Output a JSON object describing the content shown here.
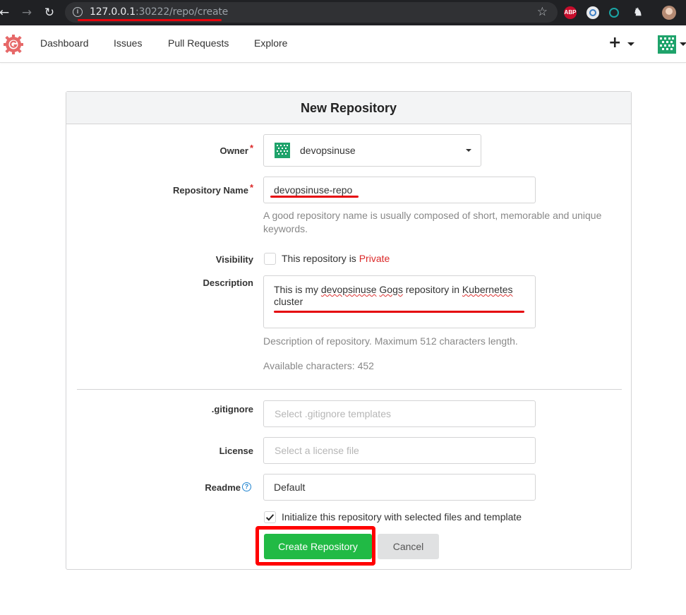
{
  "browser": {
    "url_host": "127.0.0.1",
    "url_rest": ":30222/repo/create",
    "back_icon": "arrow-left-icon",
    "forward_icon": "arrow-right-icon",
    "reload_icon": "reload-icon",
    "extensions": {
      "abp": "ABP"
    }
  },
  "nav": {
    "items": [
      "Dashboard",
      "Issues",
      "Pull Requests",
      "Explore"
    ],
    "plus": "+"
  },
  "form": {
    "title": "New Repository",
    "owner": {
      "label": "Owner",
      "required": "*",
      "value": "devopsinuse"
    },
    "repo_name": {
      "label": "Repository Name",
      "required": "*",
      "value": "devopsinuse-repo",
      "help": "A good repository name is usually composed of short, memorable and unique keywords."
    },
    "visibility": {
      "label": "Visibility",
      "text": "This repository is",
      "private": "Private",
      "checked": false
    },
    "description": {
      "label": "Description",
      "line1_a": "This is my",
      "line1_b": "devopsinuse",
      "line1_c": "Gogs",
      "line1_d": "repository in",
      "line1_e": "Kubernetes",
      "line2": "cluster",
      "help": "Description of repository. Maximum 512 characters length.",
      "available": "Available characters: 452"
    },
    "gitignore": {
      "label": ".gitignore",
      "placeholder": "Select .gitignore templates"
    },
    "license": {
      "label": "License",
      "placeholder": "Select a license file"
    },
    "readme": {
      "label": "Readme",
      "value": "Default"
    },
    "init": {
      "text": "Initialize this repository with selected files and template",
      "checked": true
    },
    "create_button": "Create Repository",
    "cancel_button": "Cancel"
  },
  "colors": {
    "primary": "#21ba45",
    "required": "#db2828",
    "annotation": "#ff0000"
  }
}
